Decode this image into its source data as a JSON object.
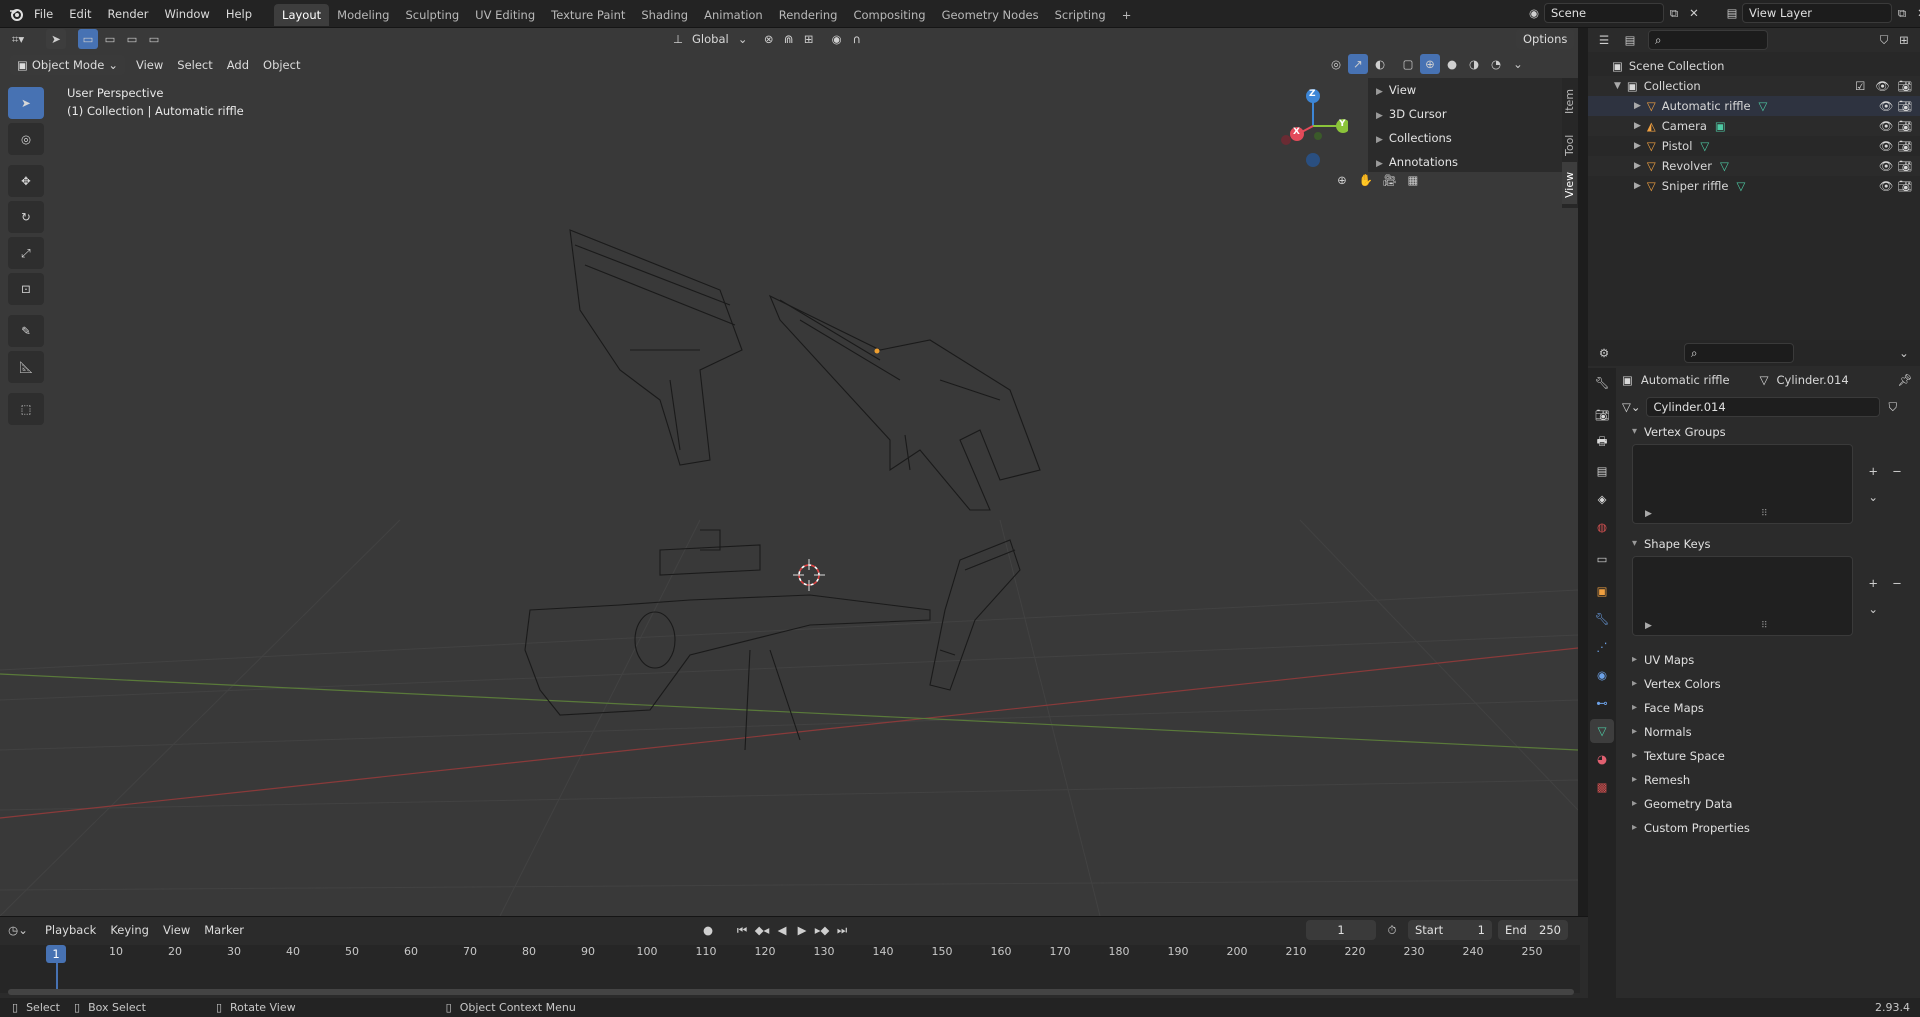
{
  "top_menu": [
    "File",
    "Edit",
    "Render",
    "Window",
    "Help"
  ],
  "workspace_tabs": [
    "Layout",
    "Modeling",
    "Sculpting",
    "UV Editing",
    "Texture Paint",
    "Shading",
    "Animation",
    "Rendering",
    "Compositing",
    "Geometry Nodes",
    "Scripting"
  ],
  "active_workspace": "Layout",
  "scene": "Scene",
  "view_layer": "View Layer",
  "viewport": {
    "mode": "Object Mode",
    "menus": [
      "View",
      "Select",
      "Add",
      "Object"
    ],
    "transform_orientation": "Global",
    "options_label": "Options",
    "perspective_label": "User Perspective",
    "collection_label": "(1) Collection | Automatic riffle",
    "gizmo": {
      "x": "X",
      "y": "Y",
      "z": "Z"
    }
  },
  "npanel": {
    "sections": [
      "View",
      "3D Cursor",
      "Collections",
      "Annotations"
    ],
    "tabs": [
      "Item",
      "Tool",
      "View"
    ],
    "active_tab": "View"
  },
  "outliner": {
    "root": "Scene Collection",
    "collection": "Collection",
    "items": [
      "Automatic riffle",
      "Camera",
      "Pistol",
      "Revolver",
      "Sniper riffle"
    ]
  },
  "properties": {
    "object_name": "Automatic riffle",
    "mesh_name": "Cylinder.014",
    "data_field": "Cylinder.014",
    "open_sections": [
      "Vertex Groups",
      "Shape Keys"
    ],
    "closed_sections": [
      "UV Maps",
      "Vertex Colors",
      "Face Maps",
      "Normals",
      "Texture Space",
      "Remesh",
      "Geometry Data",
      "Custom Properties"
    ]
  },
  "timeline": {
    "menus": [
      "Playback",
      "Keying",
      "View",
      "Marker"
    ],
    "current_frame": "1",
    "start_label": "Start",
    "start": "1",
    "end_label": "End",
    "end": "250",
    "ticks": [
      "1",
      "10",
      "20",
      "30",
      "40",
      "50",
      "60",
      "70",
      "80",
      "90",
      "100",
      "110",
      "120",
      "130",
      "140",
      "150",
      "160",
      "170",
      "180",
      "190",
      "200",
      "210",
      "220",
      "230",
      "240",
      "250"
    ]
  },
  "statusbar": {
    "select": "Select",
    "box_select": "Box Select",
    "rotate": "Rotate View",
    "context": "Object Context Menu",
    "version": "2.93.4"
  },
  "colors": {
    "accent": "#4772b3",
    "x_axis": "#e34b5a",
    "y_axis": "#8bc43a",
    "z_axis": "#3d86d6"
  }
}
